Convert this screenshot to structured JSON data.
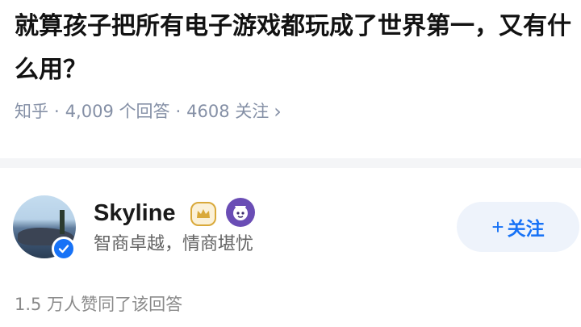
{
  "question": {
    "title": "就算孩子把所有电子游戏都玩成了世界第一，又有什么用？",
    "source": "知乎",
    "answers_count": "4,009 个回答",
    "followers_count": "4608 关注",
    "separator": "·",
    "chevron": "›"
  },
  "answer": {
    "author_name": "Skyline",
    "author_headline": "智商卓越，情商堪忧",
    "follow_button_plus": "+",
    "follow_button_label": "关注",
    "vote_summary": "1.5 万人赞同了该回答"
  },
  "icons": {
    "avatar": "landscape-avatar",
    "verified": "verified-check-icon",
    "crown": "crown-badge-icon",
    "medal": "medal-badge-icon"
  },
  "colors": {
    "title": "#121212",
    "meta": "#8590a6",
    "accent": "#1772f6",
    "follow_bg": "#eef3fb",
    "divider": "#f4f5f7",
    "crown": "#d9a93a",
    "medal": "#6a4db5"
  }
}
